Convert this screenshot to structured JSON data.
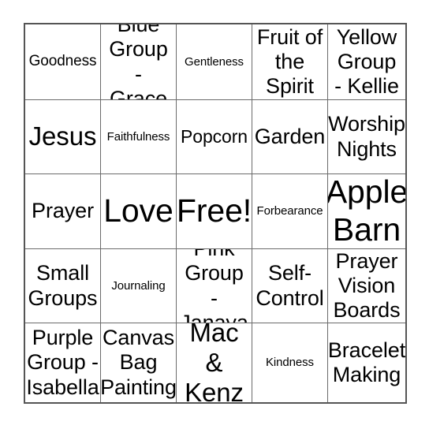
{
  "card": {
    "type": "bingo-card",
    "rows": 5,
    "columns": 5,
    "border_color": "#555555",
    "grid_line_color": "#6b6b6b",
    "background_color": "#ffffff",
    "text_color": "#000000",
    "free_space": "Free!",
    "cells": [
      [
        {
          "label": "Goodness",
          "size": "sm"
        },
        {
          "label": "Blue\nGroup\n- Grace",
          "size": "lg"
        },
        {
          "label": "Gentleness",
          "size": "xs"
        },
        {
          "label": "Fruit of\nthe\nSpirit",
          "size": "lg"
        },
        {
          "label": "Yellow\nGroup\n- Kellie",
          "size": "lg"
        }
      ],
      [
        {
          "label": "Jesus",
          "size": "xl"
        },
        {
          "label": "Faithfulness",
          "size": "xs"
        },
        {
          "label": "Popcorn",
          "size": "md"
        },
        {
          "label": "Garden",
          "size": "lg"
        },
        {
          "label": "Worship\nNights",
          "size": "lg"
        }
      ],
      [
        {
          "label": "Prayer",
          "size": "lg"
        },
        {
          "label": "Love",
          "size": "xxl"
        },
        {
          "label": "Free!",
          "size": "xxl"
        },
        {
          "label": "Forbearance",
          "size": "xs"
        },
        {
          "label": "Apple\nBarn",
          "size": "xxl"
        }
      ],
      [
        {
          "label": "Small\nGroups",
          "size": "lg"
        },
        {
          "label": "Journaling",
          "size": "xs"
        },
        {
          "label": "Pink\nGroup -\nJanaya",
          "size": "lg"
        },
        {
          "label": "Self-\nControl",
          "size": "lg"
        },
        {
          "label": "Prayer\nVision\nBoards",
          "size": "lg"
        }
      ],
      [
        {
          "label": "Purple\nGroup -\nIsabella",
          "size": "lg"
        },
        {
          "label": "Canvas\nBag\nPainting",
          "size": "lg"
        },
        {
          "label": "Mac &\nKenz",
          "size": "xl"
        },
        {
          "label": "Kindness",
          "size": "xs"
        },
        {
          "label": "Bracelet\nMaking",
          "size": "lg"
        }
      ]
    ]
  }
}
